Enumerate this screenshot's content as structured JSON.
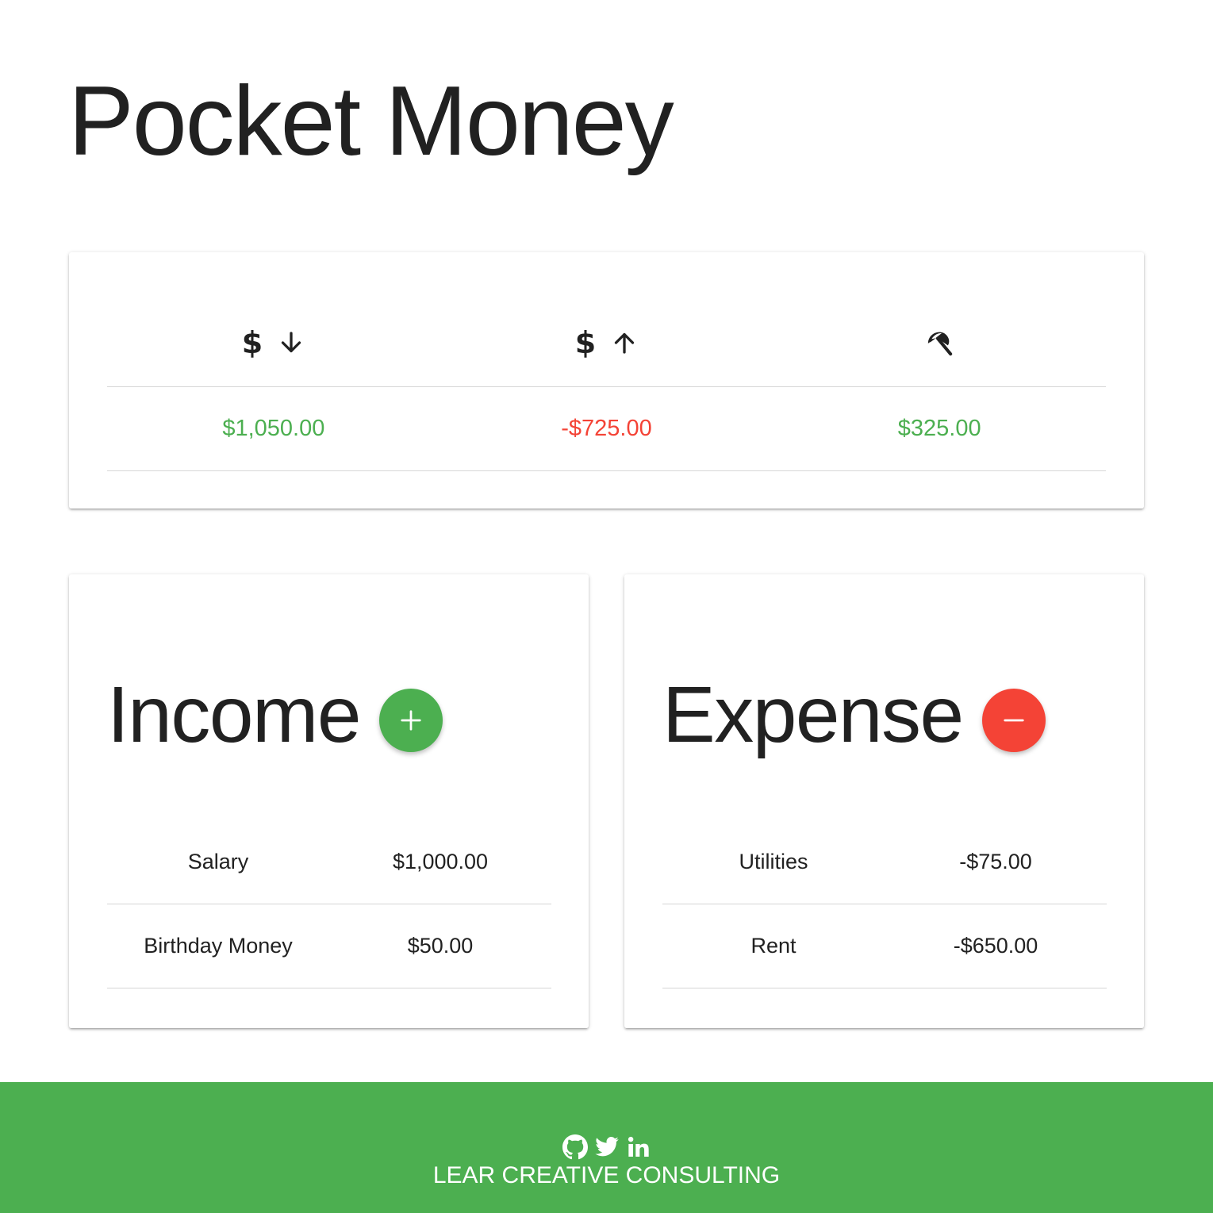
{
  "header": {
    "title": "Pocket Money"
  },
  "summary": {
    "columns": [
      {
        "icon": "dollar-arrow-down-icon",
        "value": "$1,050.00",
        "color": "#4caf50"
      },
      {
        "icon": "dollar-arrow-up-icon",
        "value": "-$725.00",
        "color": "#f44336"
      },
      {
        "icon": "beach-umbrella-icon",
        "value": "$325.00",
        "color": "#4caf50"
      }
    ]
  },
  "income": {
    "heading": "Income",
    "add_icon": "plus-icon",
    "button_color": "#4caf50",
    "rows": [
      {
        "label": "Salary",
        "amount": "$1,000.00"
      },
      {
        "label": "Birthday Money",
        "amount": "$50.00"
      }
    ]
  },
  "expense": {
    "heading": "Expense",
    "add_icon": "minus-icon",
    "button_color": "#f44336",
    "rows": [
      {
        "label": "Utilities",
        "amount": "-$75.00"
      },
      {
        "label": "Rent",
        "amount": "-$650.00"
      }
    ]
  },
  "footer": {
    "icons": [
      "github-icon",
      "twitter-icon",
      "linkedin-icon"
    ],
    "text": "LEAR CREATIVE CONSULTING",
    "background": "#4caf50"
  }
}
